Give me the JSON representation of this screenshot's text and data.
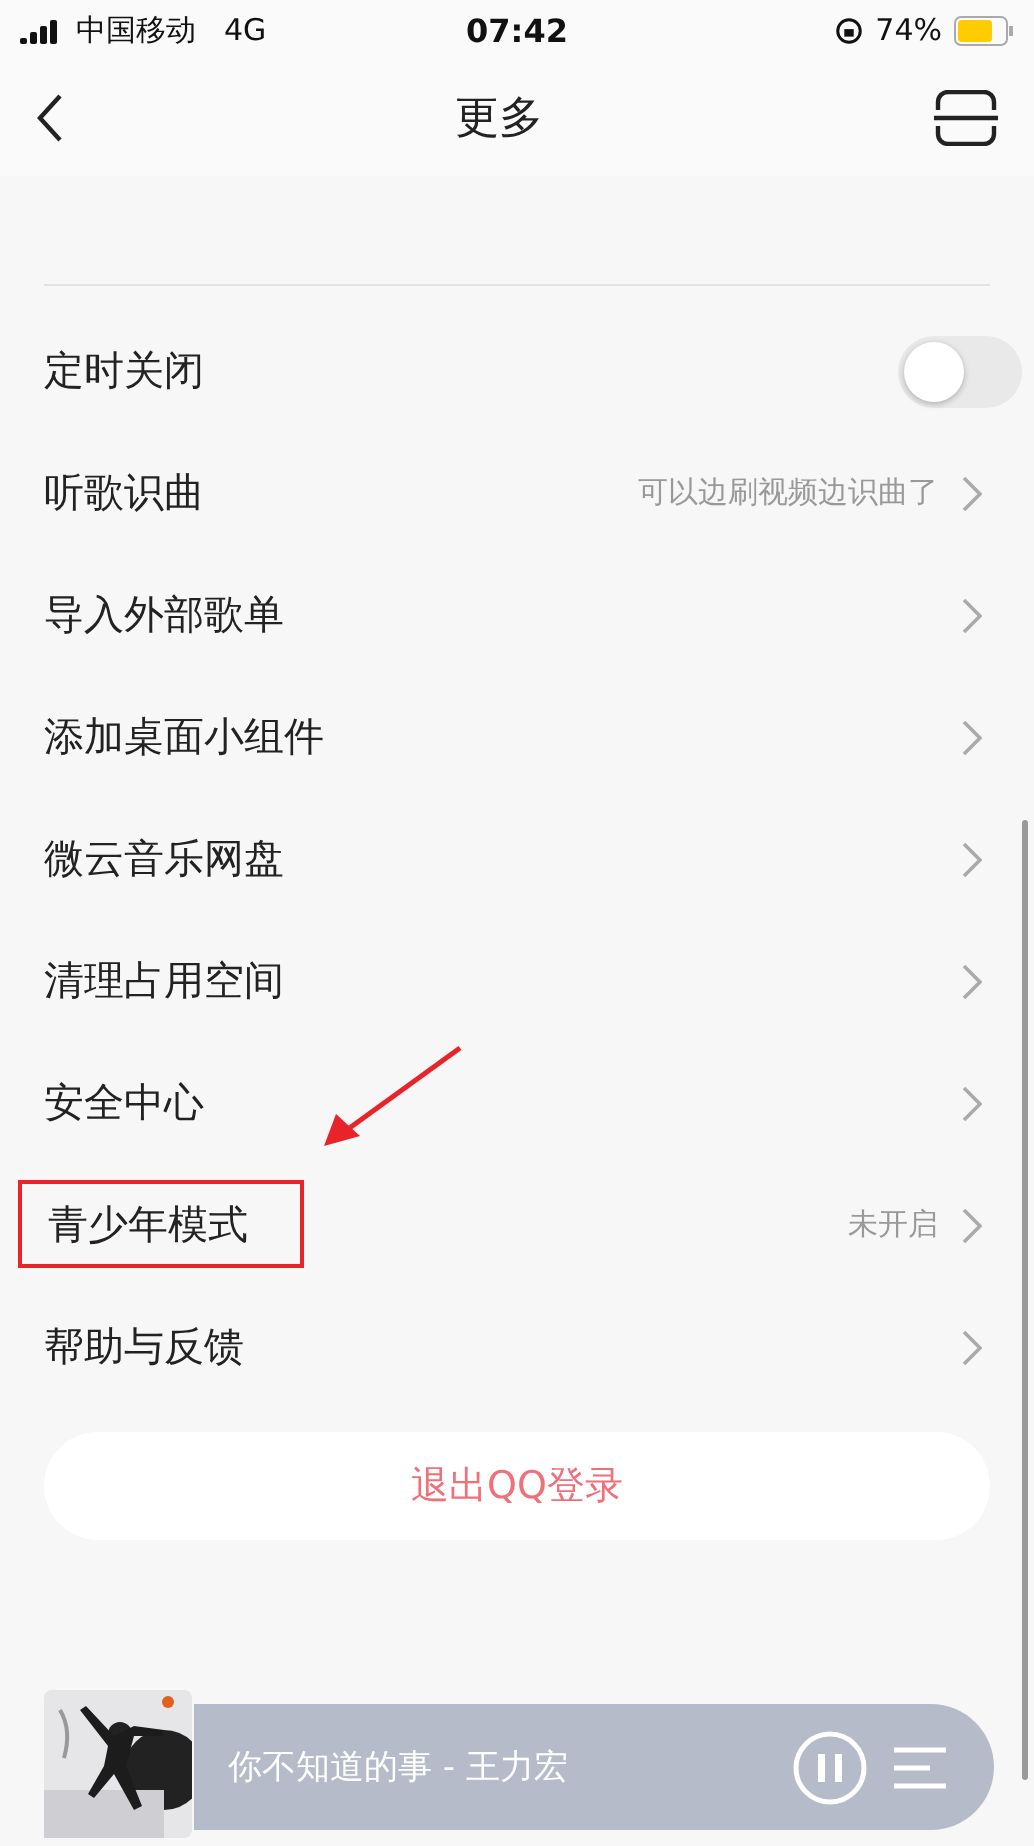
{
  "status_bar": {
    "carrier": "中国移动",
    "network": "4G",
    "time": "07:42",
    "battery": "74%"
  },
  "nav": {
    "title": "更多"
  },
  "rows": [
    {
      "kind": "toggle",
      "label": "定时关闭",
      "on": false,
      "highlighted": false
    },
    {
      "kind": "link",
      "label": "听歌识曲",
      "value": "可以边刷视频边识曲了",
      "highlighted": false
    },
    {
      "kind": "link",
      "label": "导入外部歌单",
      "highlighted": false
    },
    {
      "kind": "link",
      "label": "添加桌面小组件",
      "highlighted": false
    },
    {
      "kind": "link",
      "label": "微云音乐网盘",
      "highlighted": false
    },
    {
      "kind": "link",
      "label": "清理占用空间",
      "highlighted": false
    },
    {
      "kind": "link",
      "label": "安全中心",
      "highlighted": false
    },
    {
      "kind": "link",
      "label": "青少年模式",
      "value": "未开启",
      "highlighted": true
    },
    {
      "kind": "link",
      "label": "帮助与反馈",
      "highlighted": false
    }
  ],
  "logout_button": "退出QQ登录",
  "player": {
    "song": "你不知道的事 - 王力宏",
    "playing": true
  }
}
